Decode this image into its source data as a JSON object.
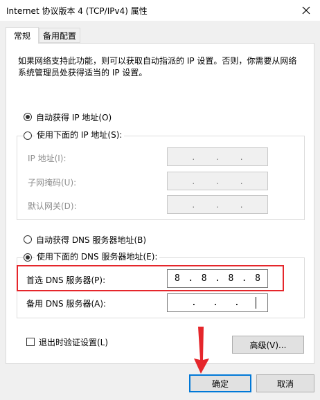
{
  "window": {
    "title": "Internet 协议版本 4 (TCP/IPv4) 属性"
  },
  "tabs": [
    {
      "label": "常规"
    },
    {
      "label": "备用配置"
    }
  ],
  "description": "如果网络支持此功能，则可以获取自动指派的 IP 设置。否则，你需要从网络系统管理员处获得适当的 IP 设置。",
  "ip_section": {
    "auto_label": "自动获得 IP 地址(O)",
    "manual_label": "使用下面的 IP 地址(S):",
    "auto_selected": true,
    "fields": [
      {
        "label": "IP 地址(I):"
      },
      {
        "label": "子网掩码(U):"
      },
      {
        "label": "默认网关(D):"
      }
    ]
  },
  "dns_section": {
    "auto_label": "自动获得 DNS 服务器地址(B)",
    "manual_label": "使用下面的 DNS 服务器地址(E):",
    "manual_selected": true,
    "preferred": {
      "label": "首选 DNS 服务器(P):",
      "octets": [
        "8",
        "8",
        "8",
        "8"
      ]
    },
    "alternate": {
      "label": "备用 DNS 服务器(A):",
      "octets": [
        "",
        "",
        "",
        ""
      ]
    }
  },
  "validate_label": "退出时验证设置(L)",
  "advanced_label": "高级(V)...",
  "ok_label": "确定",
  "cancel_label": "取消",
  "dot": ".",
  "colors": {
    "highlight": "#e5262b",
    "arrow": "#e5262b",
    "focus": "#0078d7"
  }
}
